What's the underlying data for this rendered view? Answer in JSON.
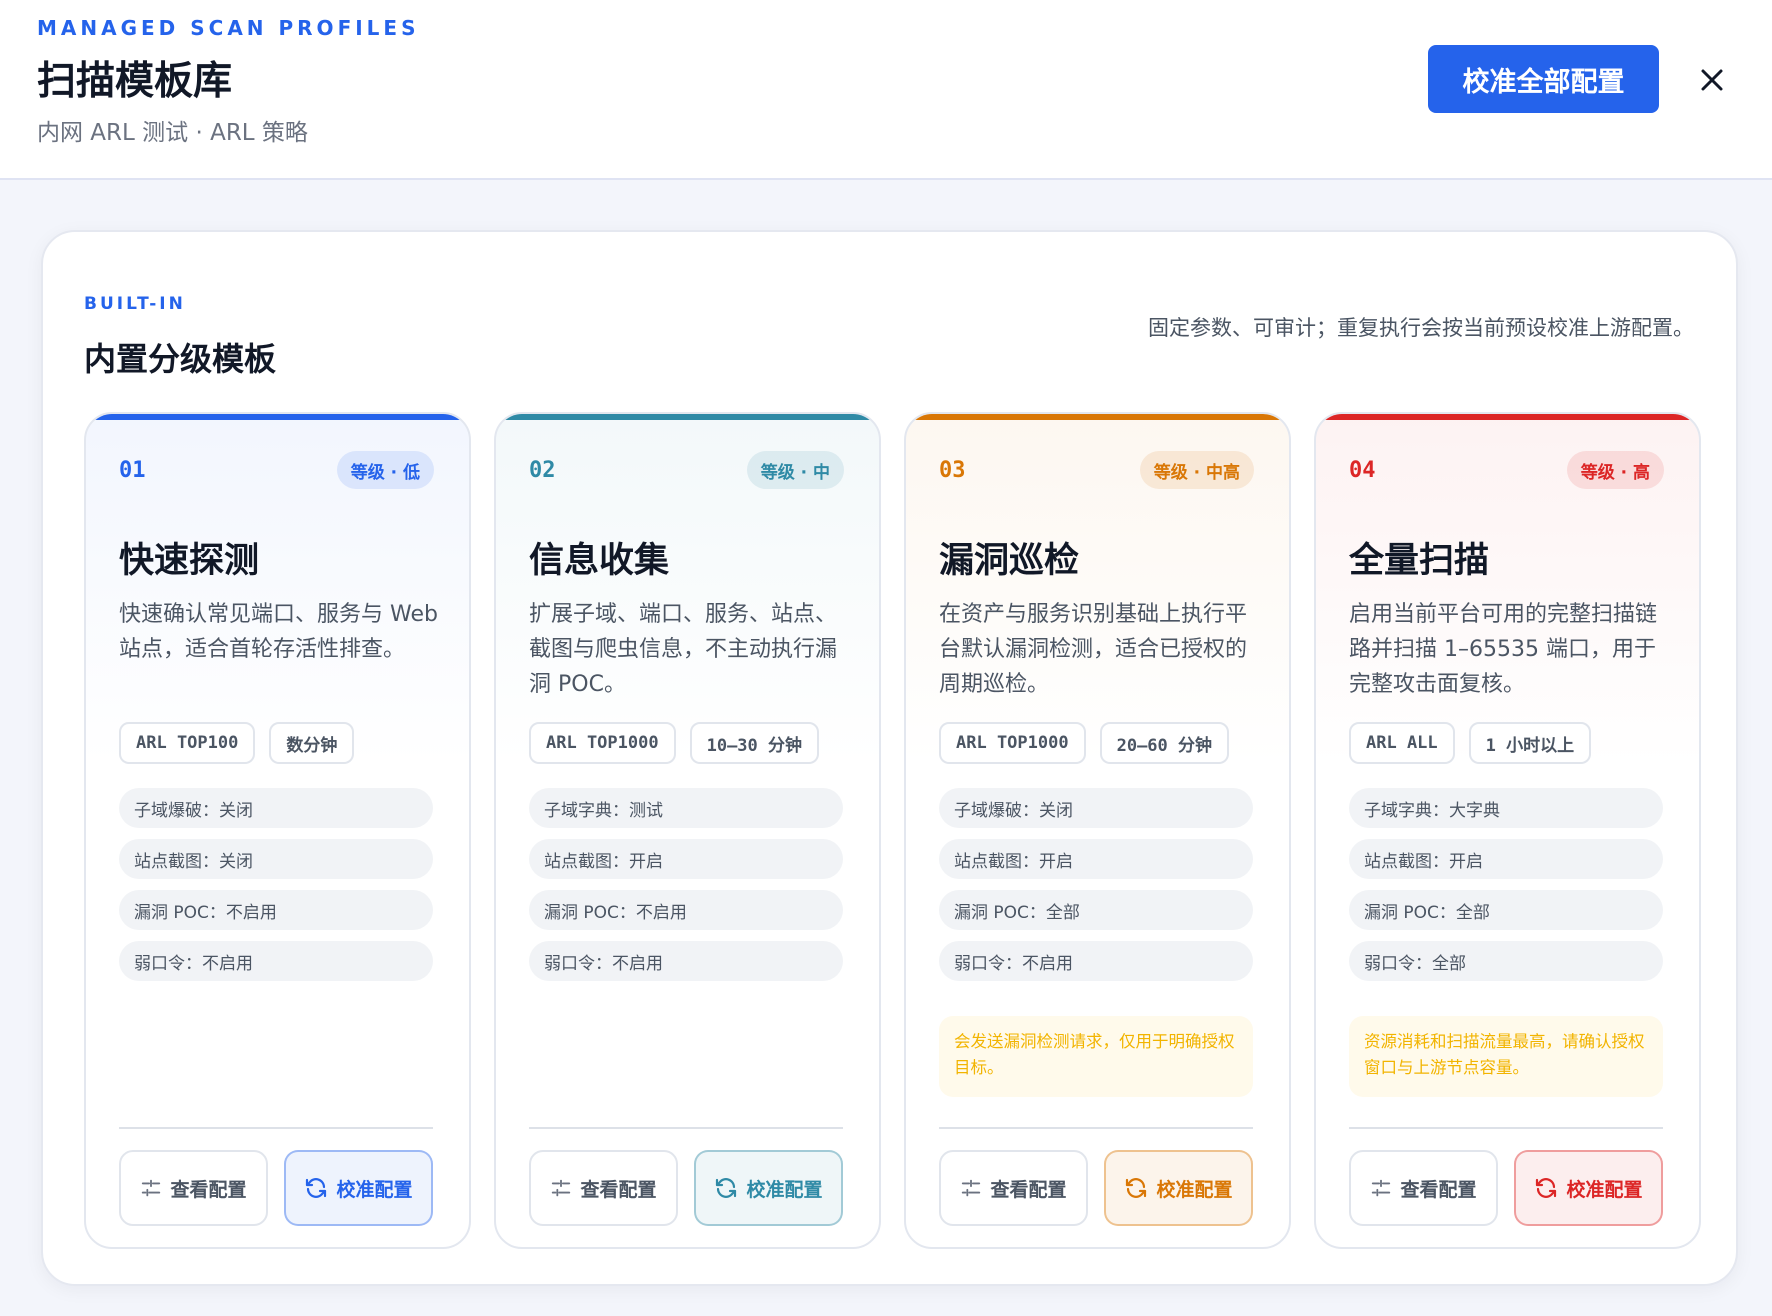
{
  "header": {
    "eyebrow": "MANAGED SCAN PROFILES",
    "title": "扫描模板库",
    "subtitle": "内网 ARL 测试 · ARL 策略",
    "primary_button": "校准全部配置",
    "close_icon": "close-icon"
  },
  "section": {
    "eyebrow": "BUILT-IN",
    "title": "内置分级模板",
    "note": "固定参数、可审计；重复执行会按当前预设校准上游配置。"
  },
  "cards": [
    {
      "num": "01",
      "level": "等级 · 低",
      "title": "快速探测",
      "desc": "快速确认常见端口、服务与 Web 站点，适合首轮存活性排查。",
      "tags": [
        "ARL TOP100",
        "数分钟"
      ],
      "params": [
        "子域爆破：关闭",
        "站点截图：关闭",
        "漏洞 POC：不启用",
        "弱口令：不启用"
      ],
      "warning": "",
      "view_label": "查看配置",
      "calibrate_label": "校准配置",
      "accent": "#2563eb"
    },
    {
      "num": "02",
      "level": "等级 · 中",
      "title": "信息收集",
      "desc": "扩展子域、端口、服务、站点、截图与爬虫信息，不主动执行漏洞 POC。",
      "tags": [
        "ARL TOP1000",
        "10–30 分钟"
      ],
      "params": [
        "子域字典：测试",
        "站点截图：开启",
        "漏洞 POC：不启用",
        "弱口令：不启用"
      ],
      "warning": "",
      "view_label": "查看配置",
      "calibrate_label": "校准配置",
      "accent": "#2f8aa6"
    },
    {
      "num": "03",
      "level": "等级 · 中高",
      "title": "漏洞巡检",
      "desc": "在资产与服务识别基础上执行平台默认漏洞检测，适合已授权的周期巡检。",
      "tags": [
        "ARL TOP1000",
        "20–60 分钟"
      ],
      "params": [
        "子域爆破：关闭",
        "站点截图：开启",
        "漏洞 POC：全部",
        "弱口令：不启用"
      ],
      "warning": "会发送漏洞检测请求，仅用于明确授权目标。",
      "view_label": "查看配置",
      "calibrate_label": "校准配置",
      "accent": "#d97706"
    },
    {
      "num": "04",
      "level": "等级 · 高",
      "title": "全量扫描",
      "desc": "启用当前平台可用的完整扫描链路并扫描 1–65535 端口，用于完整攻击面复核。",
      "tags": [
        "ARL ALL",
        "1 小时以上"
      ],
      "params": [
        "子域字典：大字典",
        "站点截图：开启",
        "漏洞 POC：全部",
        "弱口令：全部"
      ],
      "warning": "资源消耗和扫描流量最高，请确认授权窗口与上游节点容量。",
      "view_label": "查看配置",
      "calibrate_label": "校准配置",
      "accent": "#dc2626"
    }
  ]
}
